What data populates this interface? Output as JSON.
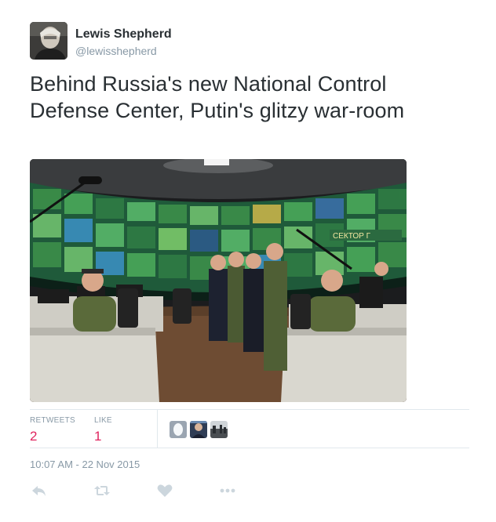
{
  "author": {
    "name": "Lewis Shepherd",
    "handle": "@lewisshepherd"
  },
  "tweet": {
    "text": "Behind Russia's new National Control Defense Center, Putin's glitzy war-room"
  },
  "media": {
    "wall_sign": "СЕКТОР  Г"
  },
  "stats": {
    "retweets_label": "RETWEETS",
    "retweets_count": "2",
    "likes_label": "LIKE",
    "likes_count": "1"
  },
  "timestamp": "10:07 AM - 22 Nov 2015",
  "actions": {
    "reply_icon": "reply-icon",
    "retweet_icon": "retweet-icon",
    "like_icon": "heart-icon",
    "more_icon": "more-icon"
  },
  "colors": {
    "text": "#292f33",
    "muted": "#8899a6",
    "count_red": "#e0245e",
    "icon": "#ccd6dd",
    "divider": "#e1e8ed"
  }
}
